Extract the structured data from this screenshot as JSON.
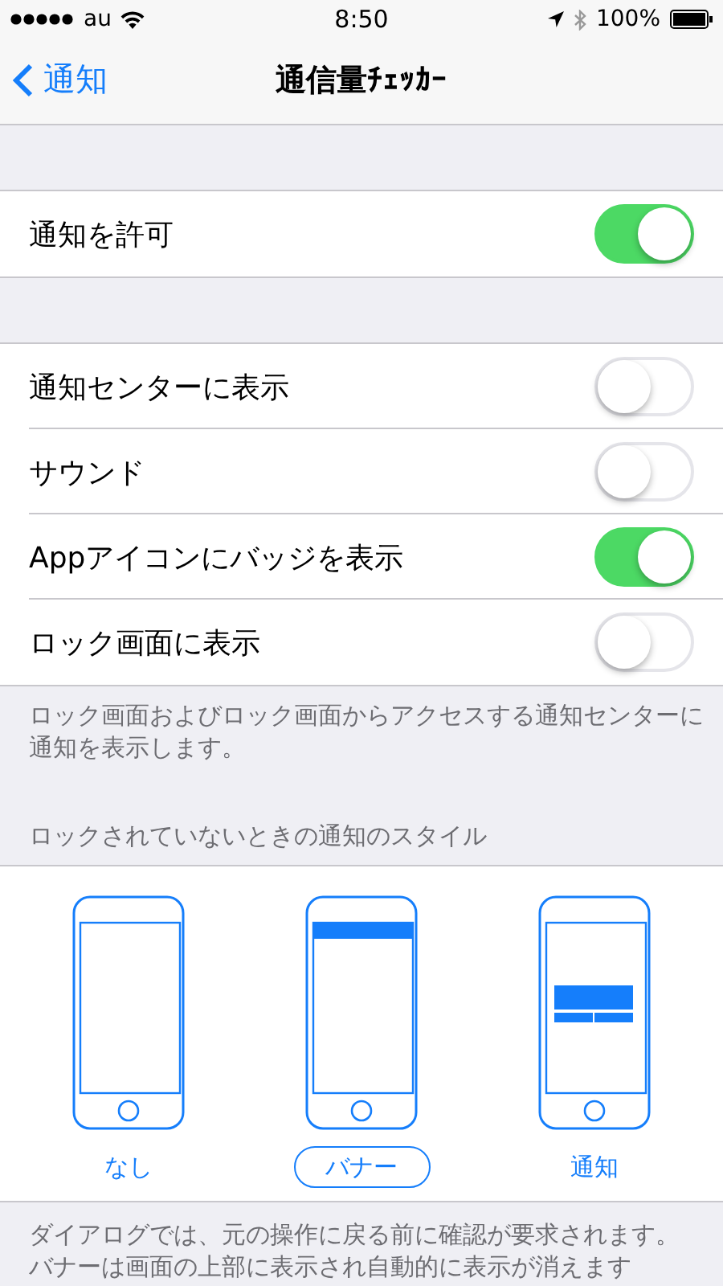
{
  "status_bar": {
    "carrier": "au",
    "time": "8:50",
    "battery": "100%"
  },
  "nav": {
    "back": "通知",
    "title": "通信量ﾁｪｯｶｰ"
  },
  "groups": [
    {
      "rows": [
        {
          "label": "通知を許可",
          "on": true
        }
      ]
    },
    {
      "rows": [
        {
          "label": "通知センターに表示",
          "on": false
        },
        {
          "label": "サウンド",
          "on": false
        },
        {
          "label": "Appアイコンにバッジを表示",
          "on": true
        },
        {
          "label": "ロック画面に表示",
          "on": false
        }
      ],
      "footer": "ロック画面およびロック画面からアクセスする通知センターに通知を表示します。"
    }
  ],
  "style_section": {
    "header": "ロックされていないときの通知のスタイル",
    "options": [
      {
        "label": "なし",
        "kind": "none",
        "selected": false
      },
      {
        "label": "バナー",
        "kind": "banner",
        "selected": true
      },
      {
        "label": "通知",
        "kind": "alert",
        "selected": false
      }
    ],
    "footer": "ダイアログでは、元の操作に戻る前に確認が要求されます。バナーは画面の上部に表示され自動的に表示が消えます"
  }
}
